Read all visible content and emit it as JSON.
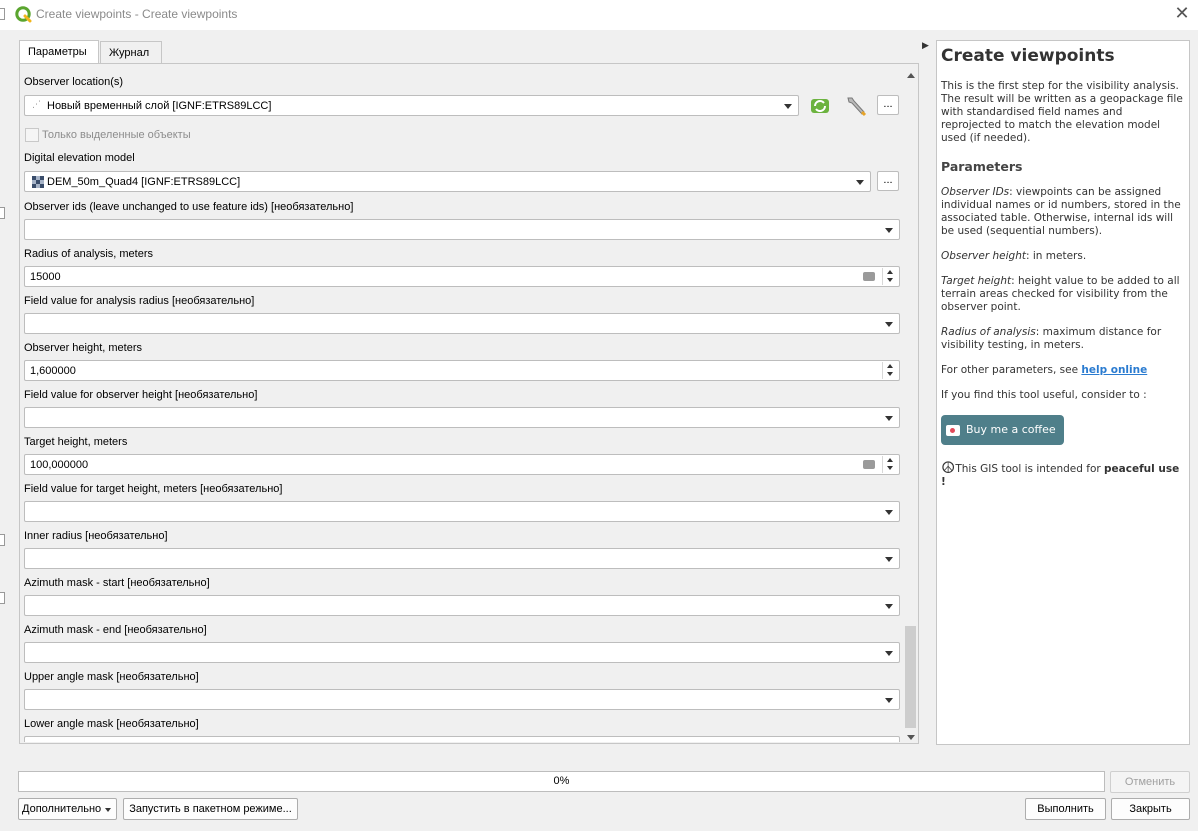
{
  "window": {
    "title": "Create viewpoints - Create viewpoints",
    "close": "✕"
  },
  "tabs": [
    "Параметры",
    "Журнал"
  ],
  "form": {
    "observer_location": {
      "label": "Observer location(s)",
      "value": "Новый временный слой [IGNF:ETRS89LCC]",
      "dots": "..."
    },
    "selected_only": {
      "label": "Только выделенные объекты",
      "checked": false
    },
    "dem": {
      "label": "Digital elevation model",
      "value": "DEM_50m_Quad4 [IGNF:ETRS89LCC]",
      "dots": "..."
    },
    "observer_ids": {
      "label": "Observer ids (leave unchanged to use feature ids) [необязательно]",
      "value": ""
    },
    "radius": {
      "label": "Radius of analysis, meters",
      "value": "15000"
    },
    "radius_field": {
      "label": "Field value for analysis radius [необязательно]",
      "value": ""
    },
    "observer_height": {
      "label": "Observer height, meters",
      "value": "1,600000"
    },
    "observer_height_field": {
      "label": "Field value for observer height [необязательно]",
      "value": ""
    },
    "target_height": {
      "label": "Target height, meters",
      "value": "100,000000"
    },
    "target_height_field": {
      "label": "Field value for target height, meters [необязательно]",
      "value": ""
    },
    "inner_radius": {
      "label": "Inner radius [необязательно]",
      "value": ""
    },
    "azimuth_start": {
      "label": "Azimuth mask - start [необязательно]",
      "value": ""
    },
    "azimuth_end": {
      "label": "Azimuth mask - end [необязательно]",
      "value": ""
    },
    "upper_angle": {
      "label": "Upper angle mask [необязательно]",
      "value": ""
    },
    "lower_angle": {
      "label": "Lower angle mask [необязательно]",
      "value": ""
    }
  },
  "help": {
    "title": "Create viewpoints",
    "intro": "This is the first step for the visibility analysis. The result will be written as a geopackage file with standardised field names and reprojected to match the elevation model used (if needed).",
    "params_heading": "Parameters",
    "p1_term": "Observer IDs",
    "p1_text": ": viewpoints can be assigned individual names or id numbers, stored in the associated table. Otherwise, internal ids will be used (sequential numbers).",
    "p2_term": "Observer height",
    "p2_text": ": in meters.",
    "p3_term": "Target height",
    "p3_text": ": height value to be added to all terrain areas checked for visibility from the observer point.",
    "p4_term": "Radius of analysis",
    "p4_text": ": maximum distance for visibility testing, in meters.",
    "other_text": "For other parameters, see ",
    "help_link": "help online",
    "useful_text": "If you find this tool useful, consider to :",
    "coffee_label": "Buy me a coffee",
    "peace_symbol": "☮",
    "peace_text": "This GIS tool is intended for ",
    "peace_bold": "peaceful use !"
  },
  "progress": {
    "value": 0,
    "label": "0%"
  },
  "buttons": {
    "cancel": "Отменить",
    "advanced": "Дополнительно",
    "batch": "Запустить в пакетном режиме...",
    "run": "Выполнить",
    "close": "Закрыть"
  }
}
